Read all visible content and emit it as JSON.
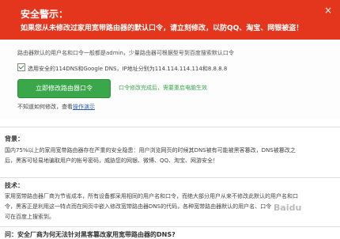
{
  "warning": {
    "title": "安全警示：",
    "text": "如果您从未修改过家用宽带路由器的默认口令，请立刻修改，以防QQ、淘宝、网银被盗！",
    "close": "×"
  },
  "form": {
    "description": "路由器默认的用户名和口令一般都是admin，少量路由器可根据型号到百度搜索默认口令",
    "dns_checked": true,
    "dns_label": "选用安全的114DNS和Google DNS，IP地址分别为114.114.114.114和8.8.8.8",
    "submit_label": "立即修改路由器口令",
    "note": "口令修改完成后，需要重启电脑生效",
    "howto_prefix": "不知道如何修改，查看",
    "howto_link": "操作演示"
  },
  "background": {
    "heading": "背景：",
    "lines": [
      "国内75%以上的家用宽带路由器存在严重的安全隐患：用户浏览网页的时候其DNS被有可能被黑客篡改，DNS被篡改之",
      "后，黑客可轻易地骗取用户的帐号密码，威胁您的网银、微博、QQ、淘宝、网游安全！"
    ]
  },
  "technique": {
    "heading": "技术：",
    "lines": [
      "家用宽带路由器厂商为节省成本，所有设备都采用相同的用户名和口令，而绝大部分用户从来不修改此默认的用户名和口",
      "令，黑客正是利用这一特点而在网页中嵌入修改宽带路由器DNS的代码，各种宽带路由器默认的用户名、口令",
      "可在百度上搜索到。"
    ]
  },
  "watermark": "Baidu",
  "question": "问：安全厂商为何无法针对黑客篡改家用宽带路由器的DNS?"
}
